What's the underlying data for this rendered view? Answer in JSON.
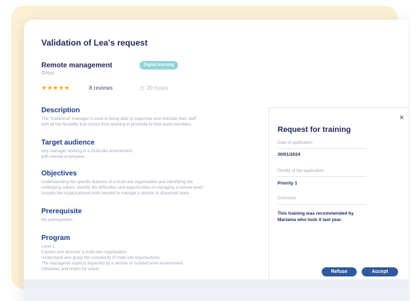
{
  "title": "Validation of Lea's request",
  "course": {
    "name": "Remote management",
    "provider": "Orsys",
    "badge": "Digital learning",
    "stars": "★★★★★",
    "reviews": "8 reviews",
    "duration": "20 hours"
  },
  "sections": [
    {
      "heading": "Description",
      "lines": [
        "The \"traditional\" manager is used to being able to supervise and motivate their staff",
        "with all the flexibility that comes from working in proximity to their team members."
      ]
    },
    {
      "heading": "Target audience",
      "lines": [
        "Any manager working in a multi-site environment",
        "with remote employees."
      ]
    },
    {
      "heading": "Objectives",
      "lines": [
        "Understanding the specific features of a multi-site organisation and identifying the",
        "underlying culture. Identify the difficulties and opportunities of managing a remote team",
        "Acquire the organizational tools needed to manage a remote or dispersed team"
      ]
    },
    {
      "heading": "Prerequisite",
      "lines": [
        "No prerequisites."
      ]
    },
    {
      "heading": "Program",
      "lines": [
        "Level 1",
        "Explore and discover a multi-site organisation",
        "Understand and grasp the complexity of multi-site organisations",
        "The managerial aspects impacted by a remote or isolated work environment",
        "Obstacles and levers for action"
      ]
    }
  ],
  "panel": {
    "title": "Request for training",
    "close": "×",
    "date_label": "Date of application",
    "date_value": "30/01/2024",
    "priority_label": "Priority of the application",
    "priority_value": "Priority 1",
    "comment_label": "Comment",
    "comment_value": "This training was recommended by Mariama who took it last year."
  },
  "buttons": {
    "refuse": "Refuse",
    "accept": "Accept"
  },
  "colors": {
    "background_card": "#fbf0d4",
    "primary_button": "#2f5a9e",
    "badge": "#8fd4d8",
    "stars": "#f5a623"
  }
}
